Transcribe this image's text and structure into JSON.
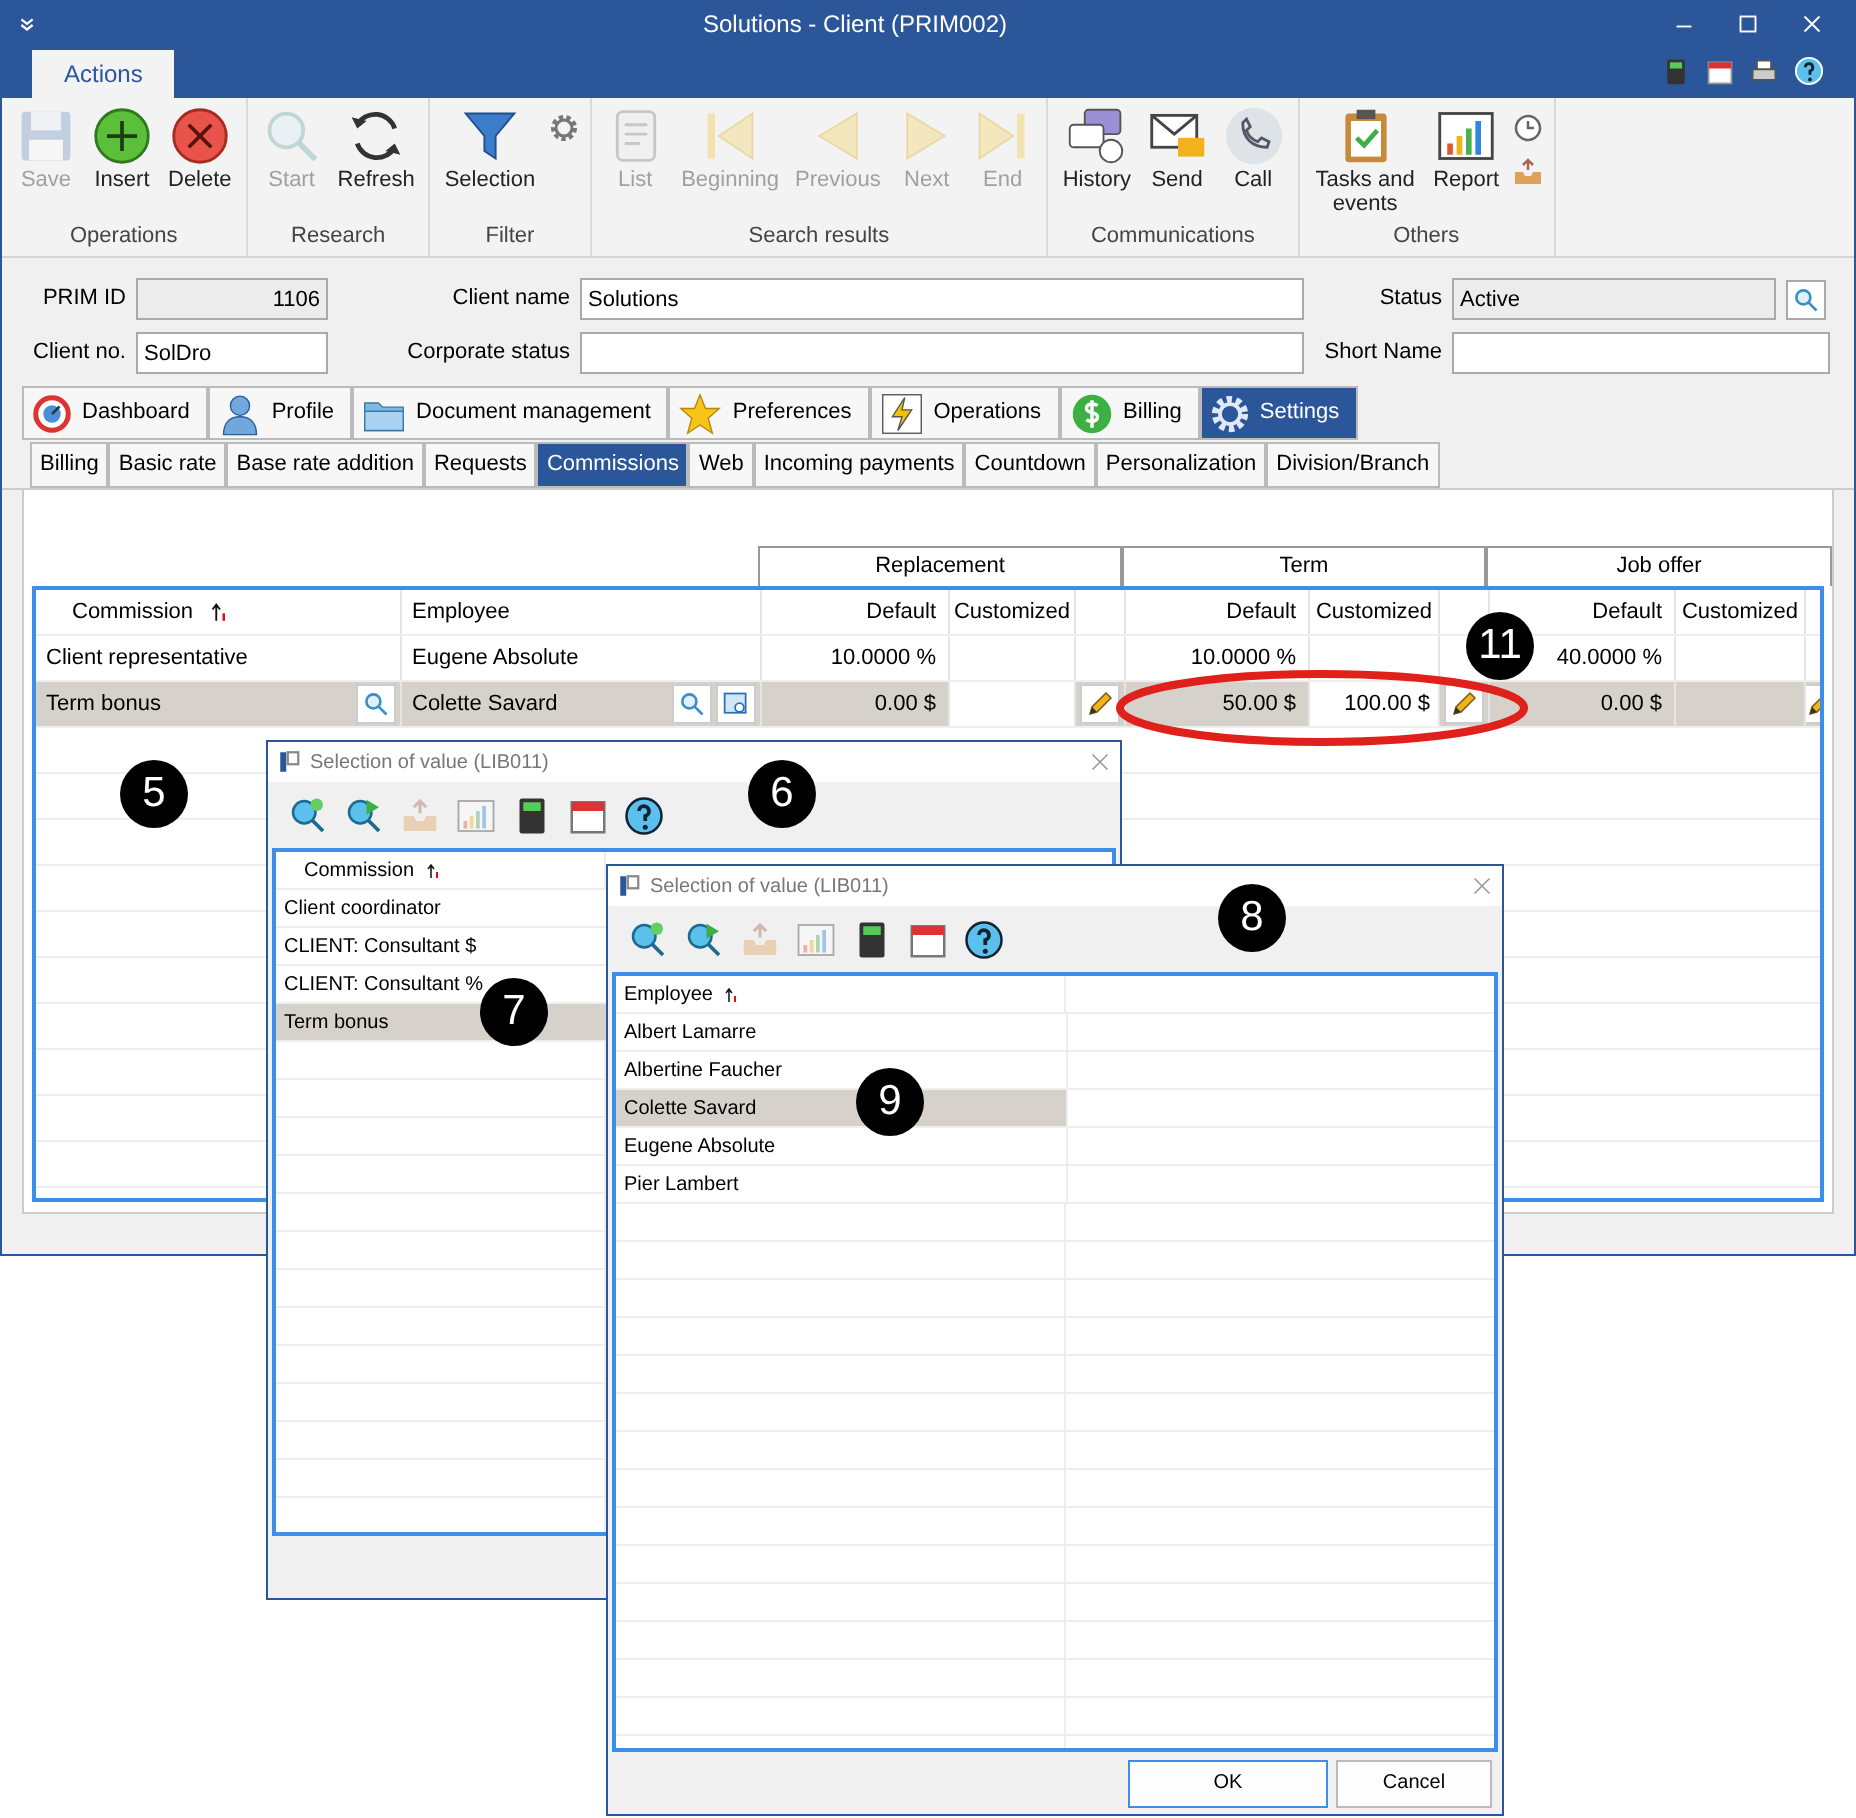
{
  "window": {
    "title": "Solutions - Client (PRIM002)"
  },
  "ribbon": {
    "tabs": [
      {
        "label": "Actions",
        "selected": true
      }
    ],
    "groups": [
      {
        "label": "Operations",
        "buttons": [
          {
            "kind": "large",
            "label": "Save",
            "disabled": true
          },
          {
            "kind": "large",
            "label": "Insert",
            "disabled": false
          },
          {
            "kind": "large",
            "label": "Delete",
            "disabled": false
          }
        ]
      },
      {
        "label": "Research",
        "buttons": [
          {
            "kind": "large",
            "label": "Start",
            "disabled": true
          },
          {
            "kind": "large",
            "label": "Refresh",
            "disabled": false
          }
        ]
      },
      {
        "label": "Filter",
        "buttons": [
          {
            "kind": "large",
            "label": "Selection",
            "disabled": false
          },
          {
            "kind": "small",
            "disabled": false
          }
        ]
      },
      {
        "label": "Search results",
        "buttons": [
          {
            "kind": "large",
            "label": "List",
            "disabled": true
          },
          {
            "kind": "large",
            "label": "Beginning",
            "disabled": true
          },
          {
            "kind": "large",
            "label": "Previous",
            "disabled": true
          },
          {
            "kind": "large",
            "label": "Next",
            "disabled": true
          },
          {
            "kind": "large",
            "label": "End",
            "disabled": true
          }
        ]
      },
      {
        "label": "Communications",
        "buttons": [
          {
            "kind": "large",
            "label": "History",
            "disabled": false
          },
          {
            "kind": "large",
            "label": "Send",
            "disabled": false
          },
          {
            "kind": "large",
            "label": "Call",
            "disabled": false
          }
        ]
      },
      {
        "label": "Others",
        "buttons": [
          {
            "kind": "large",
            "label": "Tasks and events",
            "disabled": false
          },
          {
            "kind": "large",
            "label": "Report",
            "disabled": false
          },
          {
            "kind": "small",
            "disabled": false
          },
          {
            "kind": "small",
            "disabled": false
          }
        ]
      }
    ]
  },
  "form": {
    "fields": [
      {
        "label": "PRIM ID",
        "value": "1106",
        "kind": "text",
        "read_only": true
      },
      {
        "label": "Client name",
        "value": "Solutions",
        "kind": "text",
        "read_only": false
      },
      {
        "label": "Status",
        "value": "Active",
        "kind": "lookup",
        "read_only": true
      },
      {
        "label": "Client no.",
        "value": "SolDro",
        "kind": "text",
        "read_only": false
      },
      {
        "label": "Corporate status",
        "kind": "text",
        "read_only": false
      },
      {
        "label": "Short Name",
        "kind": "text",
        "read_only": false
      }
    ]
  },
  "main_tabs": [
    {
      "label": "Dashboard",
      "selected": false
    },
    {
      "label": "Profile",
      "selected": false
    },
    {
      "label": "Document management",
      "selected": false
    },
    {
      "label": "Preferences",
      "selected": false
    },
    {
      "label": "Operations",
      "selected": false
    },
    {
      "label": "Billing",
      "selected": false
    },
    {
      "label": "Settings",
      "selected": true
    }
  ],
  "sub_tabs": [
    {
      "label": "Billing",
      "selected": false
    },
    {
      "label": "Basic rate",
      "selected": false
    },
    {
      "label": "Base rate addition",
      "selected": false
    },
    {
      "label": "Requests",
      "selected": false
    },
    {
      "label": "Commissions",
      "selected": true
    },
    {
      "label": "Web",
      "selected": false
    },
    {
      "label": "Incoming payments",
      "selected": false
    },
    {
      "label": "Countdown",
      "selected": false
    },
    {
      "label": "Personalization",
      "selected": false
    },
    {
      "label": "Division/Branch",
      "selected": false
    }
  ],
  "grid": {
    "groups": [
      {
        "label": "Replacement",
        "default_header": "Default",
        "customized_header": "Customized"
      },
      {
        "label": "Term",
        "default_header": "Default",
        "customized_header": "Customized"
      },
      {
        "label": "Job offer",
        "default_header": "Default",
        "customized_header": "Customized"
      }
    ],
    "commission_header": "Commission",
    "employee_header": "Employee",
    "rows": [
      {
        "commission": "Client representative",
        "employee": "Eugene Absolute",
        "selected": false,
        "values": [
          {
            "default": "10.0000 %"
          },
          {
            "default": "10.0000 %"
          },
          {
            "default": "40.0000 %"
          }
        ]
      },
      {
        "commission": "Term bonus",
        "employee": "Colette Savard",
        "selected": true,
        "values": [
          {
            "default": "0.00 $"
          },
          {
            "default": "50.00 $",
            "customized": "100.00 $"
          },
          {
            "default": "0.00 $"
          }
        ]
      }
    ]
  },
  "dialogs": [
    {
      "title": "Selection of value (LIB011)",
      "column": "Commission",
      "items": [
        {
          "label": "Client coordinator",
          "selected": false
        },
        {
          "label": "CLIENT: Consultant $",
          "selected": false
        },
        {
          "label": "CLIENT: Consultant %",
          "selected": false
        },
        {
          "label": "Term bonus",
          "selected": true
        }
      ]
    },
    {
      "title": "Selection of value (LIB011)",
      "column": "Employee",
      "items": [
        {
          "label": "Albert Lamarre",
          "selected": false
        },
        {
          "label": "Albertine Faucher",
          "selected": false
        },
        {
          "label": "Colette Savard",
          "selected": true
        },
        {
          "label": "Eugene Absolute",
          "selected": false
        },
        {
          "label": "Pier Lambert",
          "selected": false
        }
      ],
      "buttons": [
        "OK",
        "Cancel"
      ]
    }
  ],
  "callouts": [
    {
      "label": "5"
    },
    {
      "label": "6"
    },
    {
      "label": "7"
    },
    {
      "label": "8"
    },
    {
      "label": "9"
    },
    {
      "label": "11"
    }
  ]
}
